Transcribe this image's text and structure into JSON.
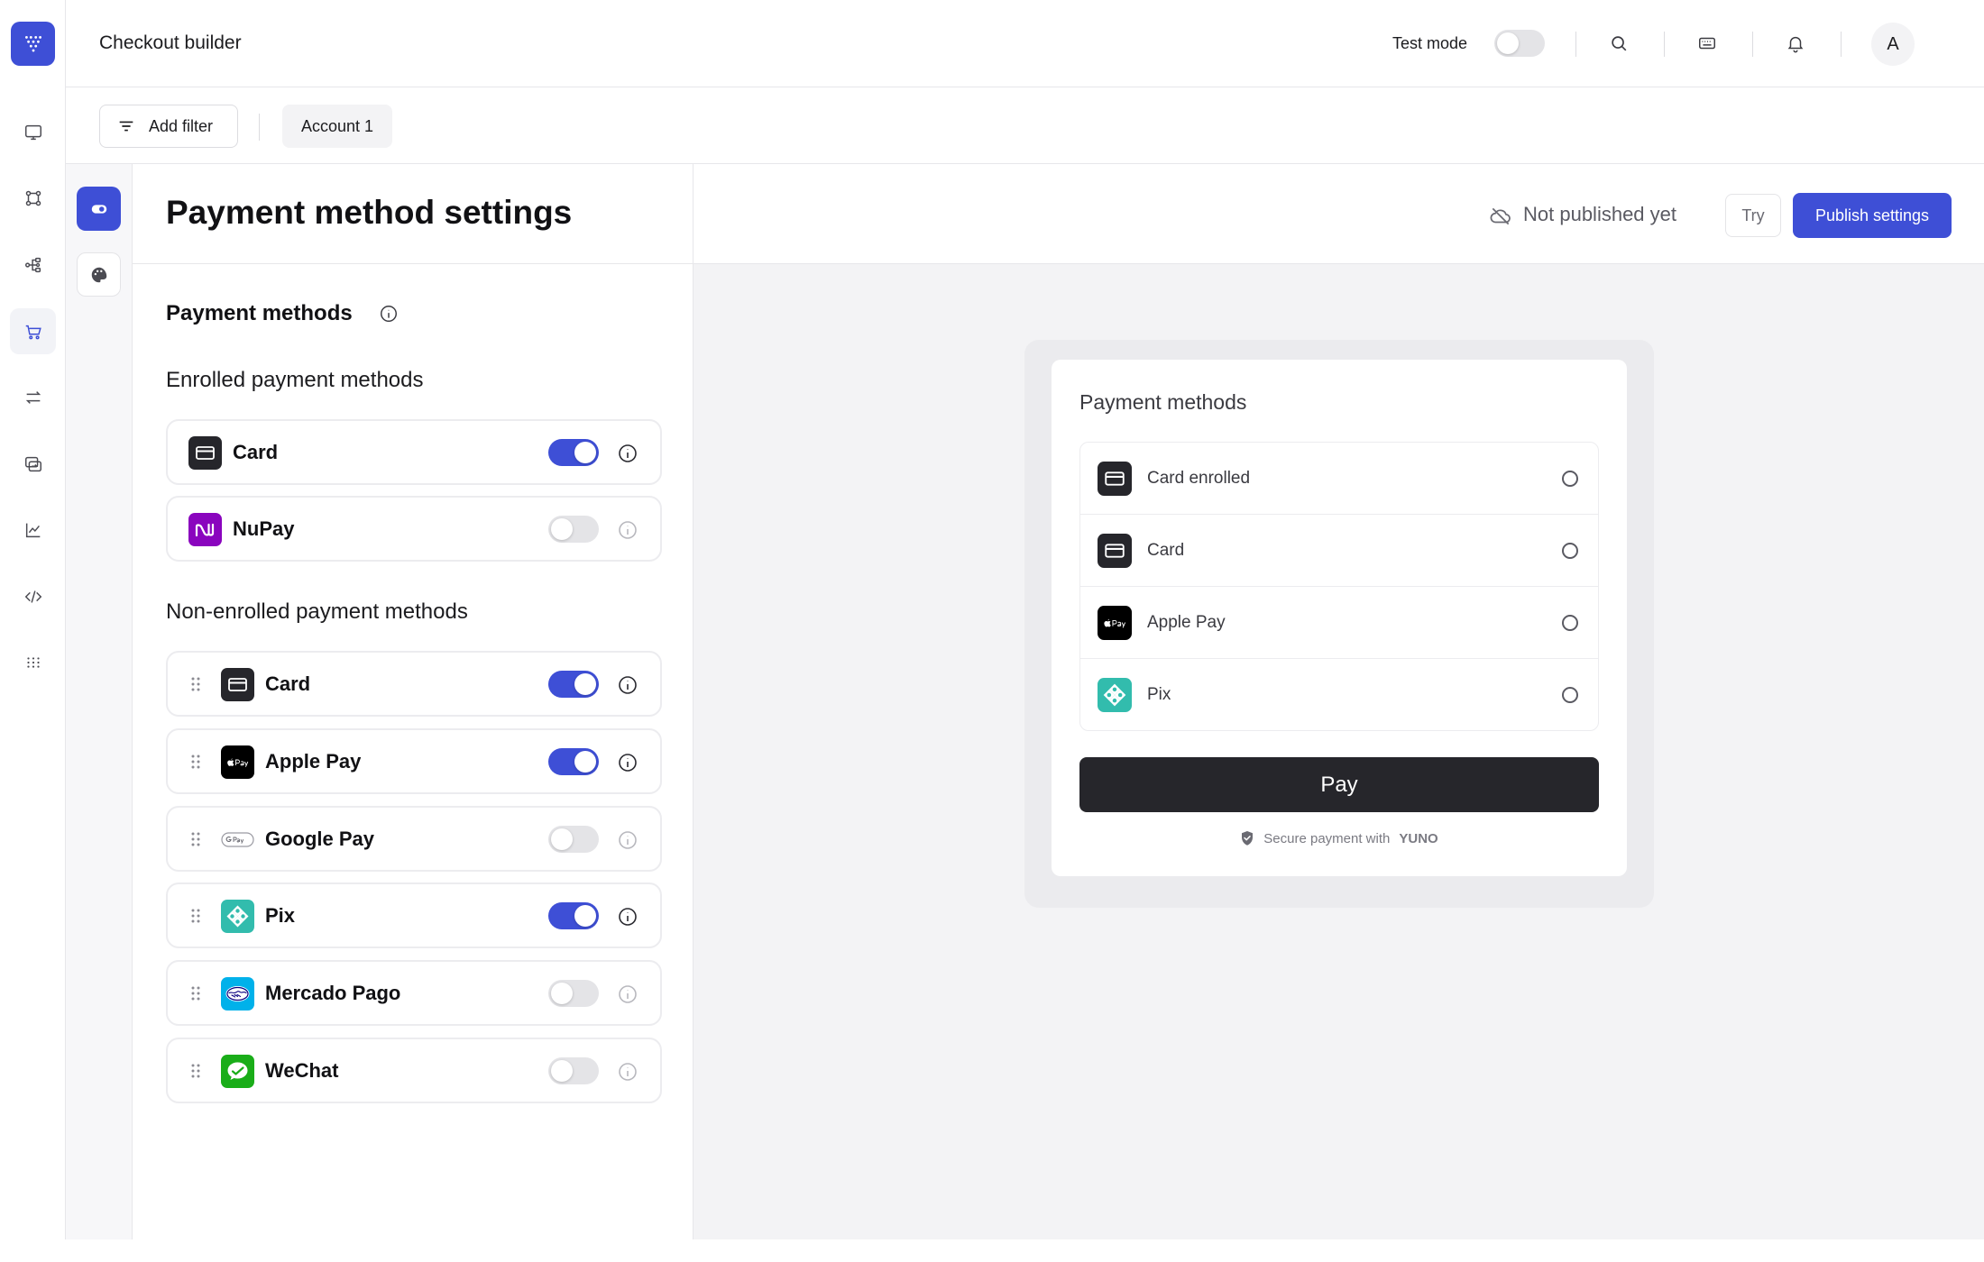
{
  "header": {
    "title": "Checkout builder",
    "test_mode_label": "Test mode",
    "test_mode_on": false,
    "avatar_initial": "A"
  },
  "filters": {
    "add_filter_label": "Add filter",
    "account_label": "Account 1"
  },
  "sidebar": {
    "items": [
      {
        "icon": "monitor-icon",
        "active": false
      },
      {
        "icon": "nodes-icon",
        "active": false
      },
      {
        "icon": "workflow-icon",
        "active": false
      },
      {
        "icon": "cart-icon",
        "active": true
      },
      {
        "icon": "transfer-icon",
        "active": false
      },
      {
        "icon": "exchange-icon",
        "active": false
      },
      {
        "icon": "chart-icon",
        "active": false
      },
      {
        "icon": "code-icon",
        "active": false
      },
      {
        "icon": "grid-dots-icon",
        "active": false
      }
    ],
    "accent_color": "#3e4fd6"
  },
  "settings": {
    "page_title": "Payment method settings",
    "section_title": "Payment methods",
    "enrolled_title": "Enrolled payment methods",
    "enrolled": [
      {
        "name": "Card",
        "enabled": true,
        "logo": "card-icon"
      },
      {
        "name": "NuPay",
        "enabled": false,
        "logo": "nupay-logo"
      }
    ],
    "non_enrolled_title": "Non-enrolled payment methods",
    "non_enrolled": [
      {
        "name": "Card",
        "enabled": true,
        "logo": "card-icon"
      },
      {
        "name": "Apple Pay",
        "enabled": true,
        "logo": "apple-pay-logo"
      },
      {
        "name": "Google Pay",
        "enabled": false,
        "logo": "google-pay-logo"
      },
      {
        "name": "Pix",
        "enabled": true,
        "logo": "pix-logo"
      },
      {
        "name": "Mercado Pago",
        "enabled": false,
        "logo": "mercado-pago-logo"
      },
      {
        "name": "WeChat",
        "enabled": false,
        "logo": "wechat-logo"
      }
    ]
  },
  "publish": {
    "status": "Not published yet",
    "try_label": "Try",
    "publish_label": "Publish settings"
  },
  "preview": {
    "title": "Payment methods",
    "options": [
      {
        "name": "Card enrolled",
        "logo": "card-icon"
      },
      {
        "name": "Card",
        "logo": "card-icon"
      },
      {
        "name": "Apple Pay",
        "logo": "apple-pay-logo"
      },
      {
        "name": "Pix",
        "logo": "pix-logo"
      }
    ],
    "pay_label": "Pay",
    "secure_text": "Secure payment with",
    "secure_brand": "YUNO"
  }
}
